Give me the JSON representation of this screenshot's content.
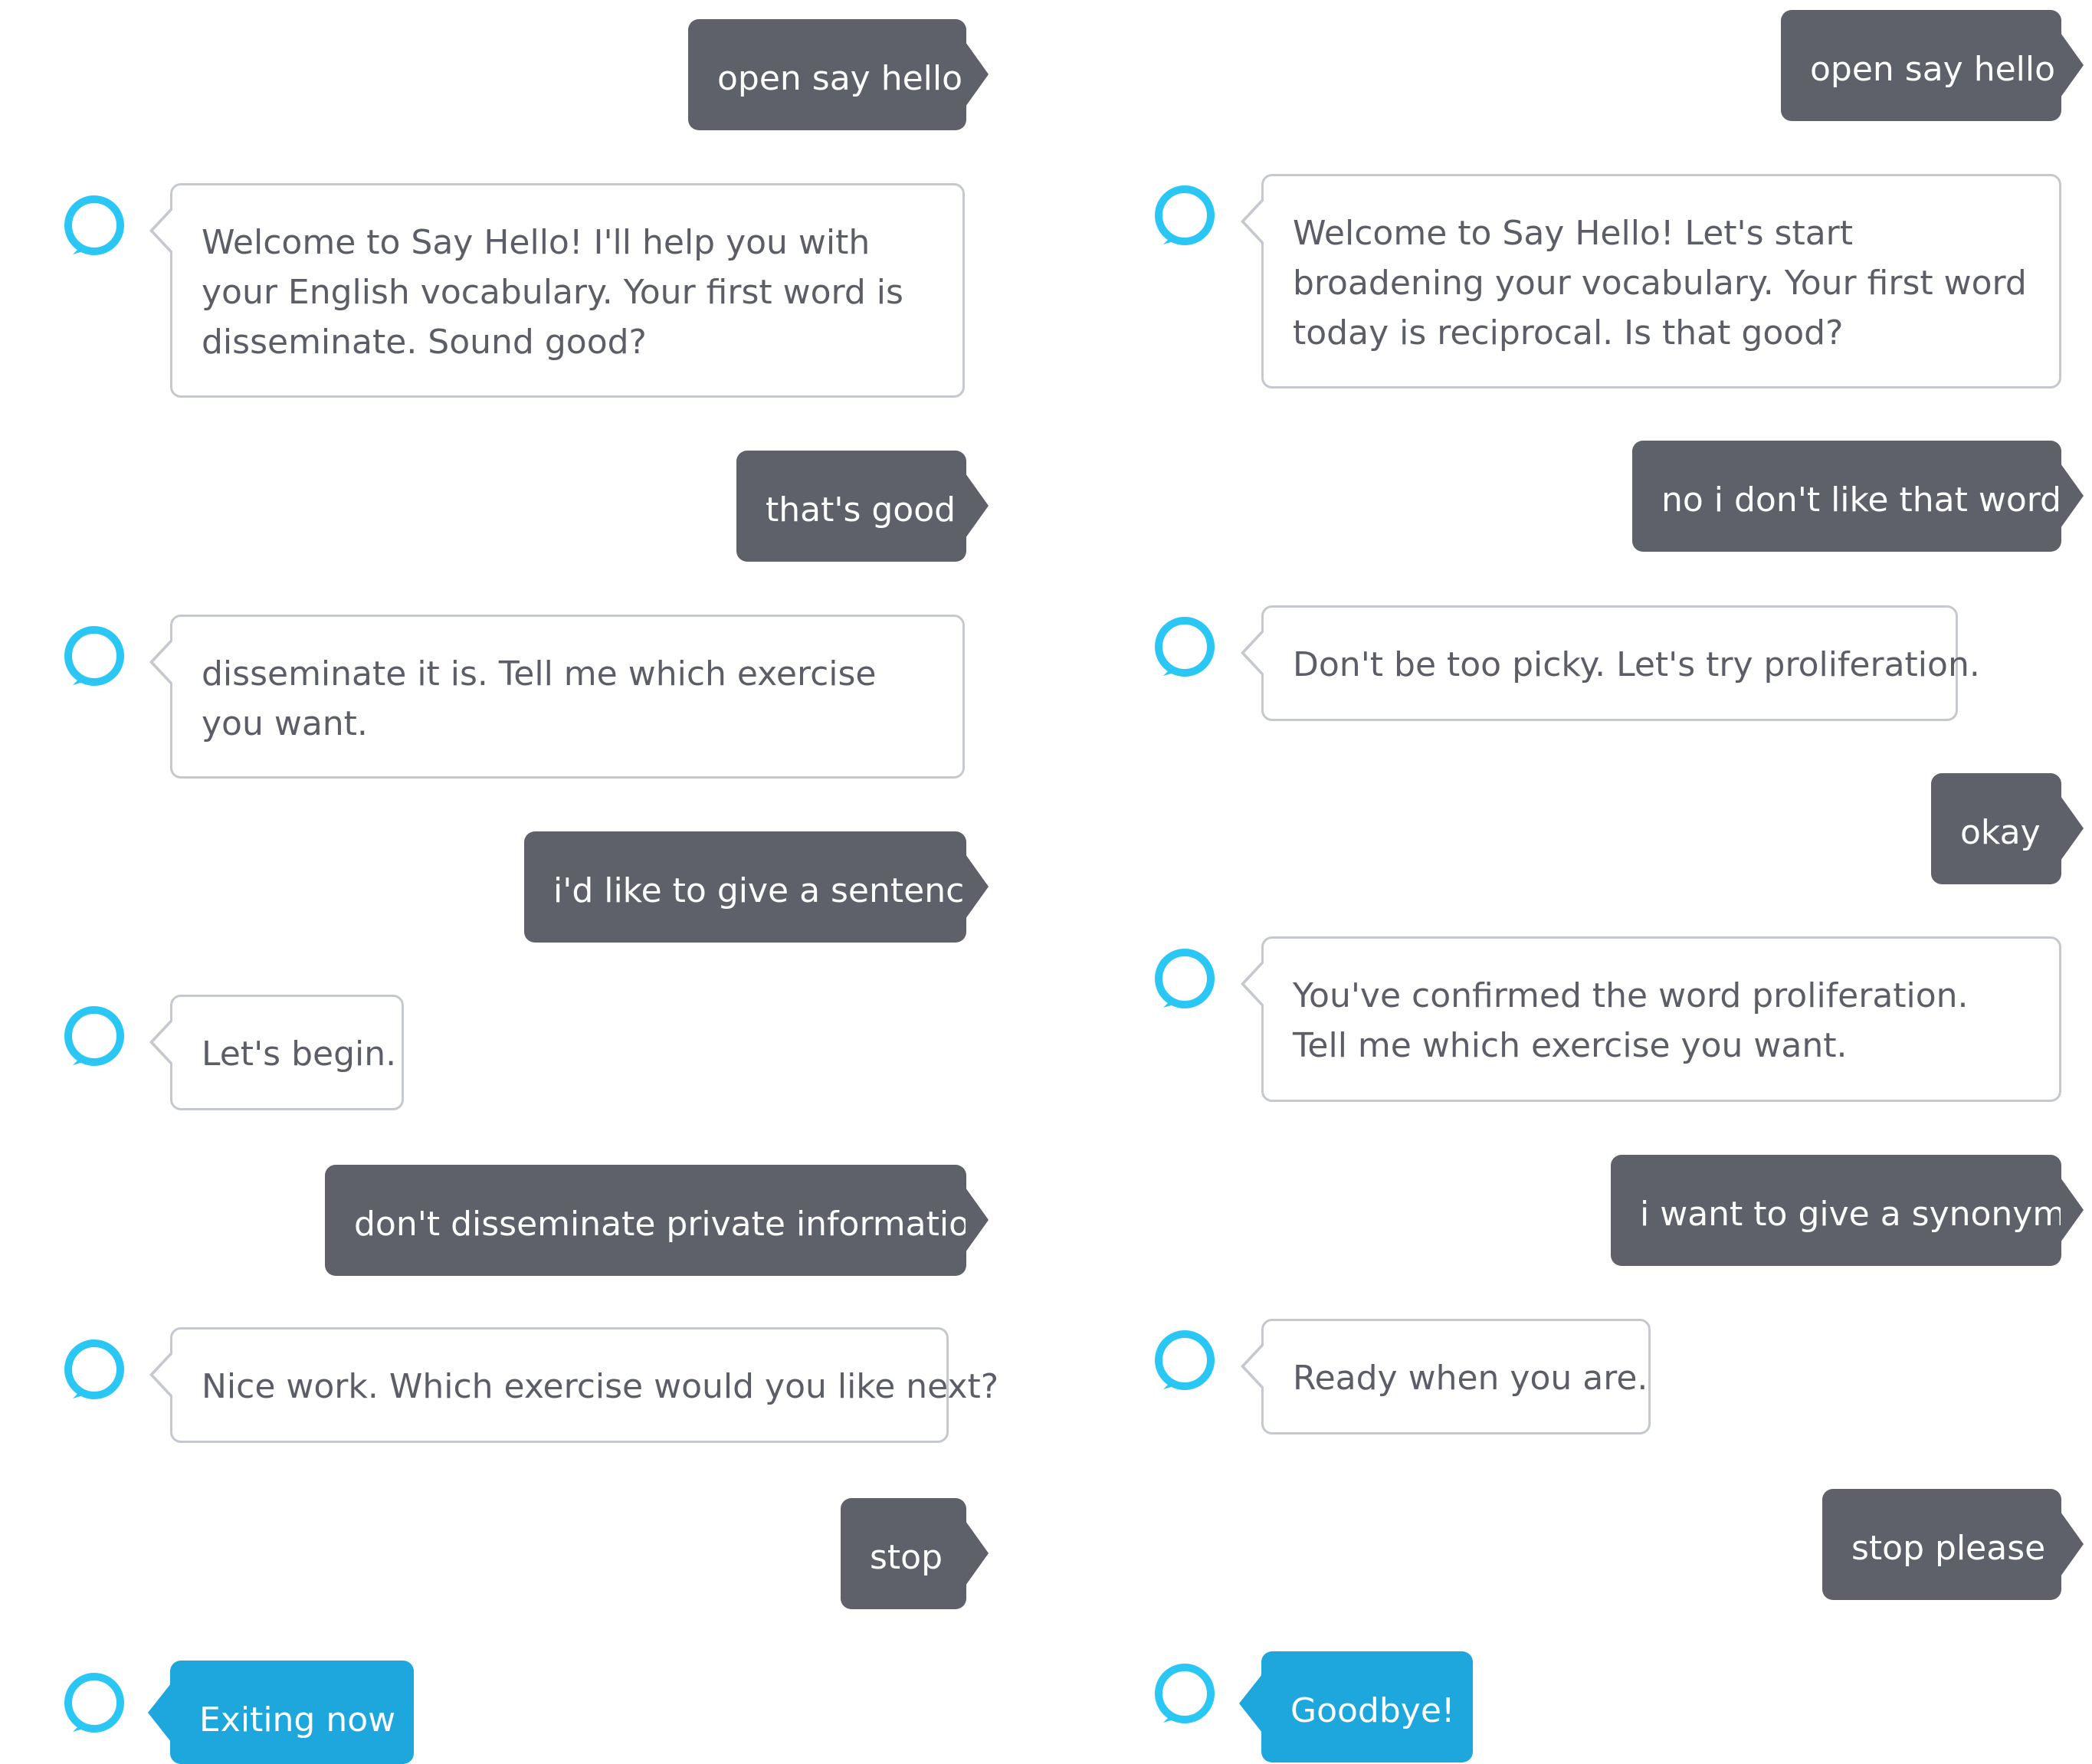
{
  "accent_color": "#1ea7dd",
  "user_bubble_color": "#5e6169",
  "conversations": [
    {
      "messages": [
        {
          "speaker": "user",
          "text": "open say hello"
        },
        {
          "speaker": "alexa",
          "text": "Welcome to Say Hello! I'll help you with your English vocabulary. Your first word is disseminate. Sound good?"
        },
        {
          "speaker": "user",
          "text": "that's good"
        },
        {
          "speaker": "alexa",
          "text": "disseminate it is. Tell me which exercise you want."
        },
        {
          "speaker": "user",
          "text": "i'd like to give a sentence"
        },
        {
          "speaker": "alexa",
          "text": "Let's begin."
        },
        {
          "speaker": "user",
          "text": "don't disseminate private information"
        },
        {
          "speaker": "alexa",
          "text": "Nice work. Which exercise would you like next?"
        },
        {
          "speaker": "user",
          "text": "stop"
        },
        {
          "speaker": "alexa",
          "text": "Exiting now"
        }
      ]
    },
    {
      "messages": [
        {
          "speaker": "user",
          "text": "open say hello"
        },
        {
          "speaker": "alexa",
          "text": "Welcome to Say Hello! Let's start broadening your vocabulary. Your first word today is reciprocal. Is that good?"
        },
        {
          "speaker": "user",
          "text": "no i don't like that word"
        },
        {
          "speaker": "alexa",
          "text": "Don't be too picky. Let's try proliferation."
        },
        {
          "speaker": "user",
          "text": "okay"
        },
        {
          "speaker": "alexa",
          "text": "You've confirmed the word proliferation. Tell me which exercise you want."
        },
        {
          "speaker": "user",
          "text": "i want to give a synonym"
        },
        {
          "speaker": "alexa",
          "text": "Ready when you are."
        },
        {
          "speaker": "user",
          "text": "stop please"
        },
        {
          "speaker": "alexa",
          "text": "Goodbye!"
        }
      ]
    }
  ]
}
